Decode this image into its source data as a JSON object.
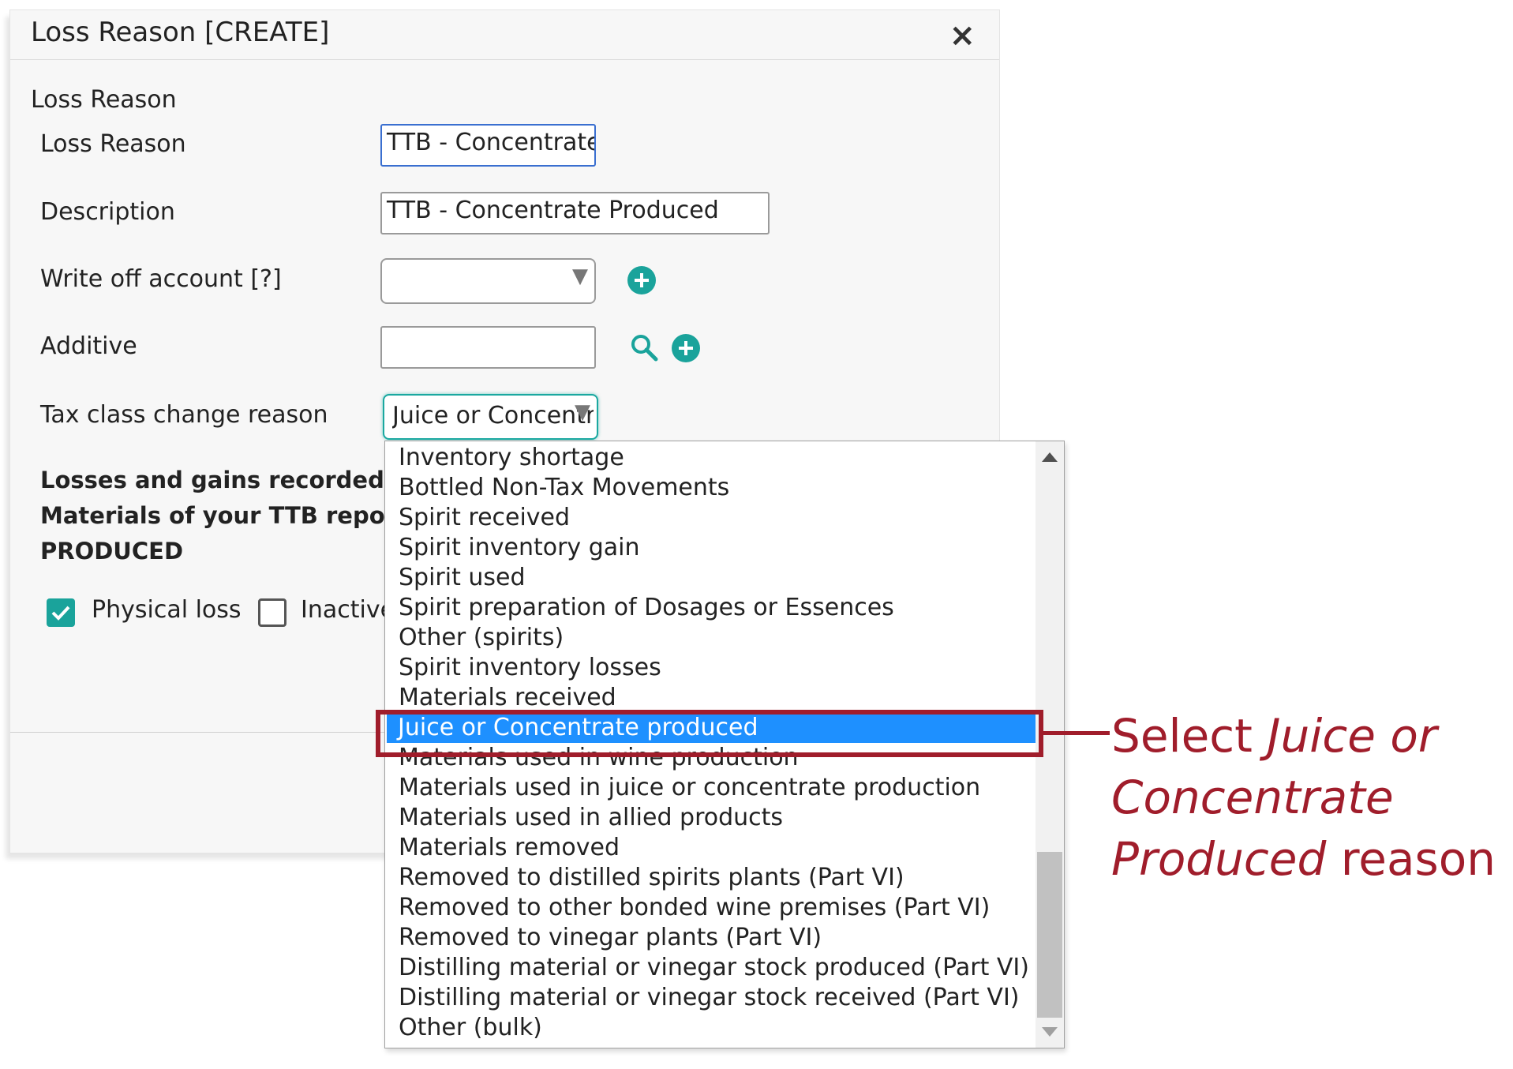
{
  "dialog": {
    "title": "Loss Reason [CREATE]",
    "close_icon": "×",
    "section_title": "Loss Reason",
    "fields": {
      "loss_reason_label": "Loss Reason",
      "loss_reason_value": "TTB - Concentrate P",
      "description_label": "Description",
      "description_value": "TTB - Concentrate Produced",
      "write_off_label": "Write off account [?]",
      "write_off_value": "",
      "additive_label": "Additive",
      "additive_value": "",
      "tax_class_label": "Tax class change reason",
      "tax_class_value": "Juice or Concentrate produced"
    },
    "info_line1": "Losses and gains recorded w",
    "info_line2": "Materials of your TTB report",
    "info_line3": "PRODUCED",
    "physical_loss_label": "Physical loss",
    "physical_loss_checked": true,
    "inactive_label": "Inactive",
    "inactive_checked": false
  },
  "dropdown": {
    "options": [
      "Inventory shortage",
      "Bottled Non-Tax Movements",
      "Spirit received",
      "Spirit inventory gain",
      "Spirit used",
      "Spirit preparation of Dosages or Essences",
      "Other (spirits)",
      "Spirit inventory losses",
      "Materials received",
      "Juice or Concentrate produced",
      "Materials used in wine production",
      "Materials used in juice or concentrate production",
      "Materials used in allied products",
      "Materials removed",
      "Removed to distilled spirits plants (Part VI)",
      "Removed to other bonded wine premises (Part VI)",
      "Removed to vinegar plants (Part VI)",
      "Distilling material or vinegar stock produced (Part VI)",
      "Distilling material or vinegar stock received (Part VI)",
      "Other (bulk)"
    ],
    "selected_index": 9
  },
  "annotation": {
    "prefix": "Select ",
    "italic": "Juice or Concentrate Produced",
    "suffix": " reason",
    "color": "#a01d2b"
  },
  "colors": {
    "accent": "#1aa39b",
    "selected_option_bg": "#1e90ff",
    "annotation": "#a01d2b"
  }
}
